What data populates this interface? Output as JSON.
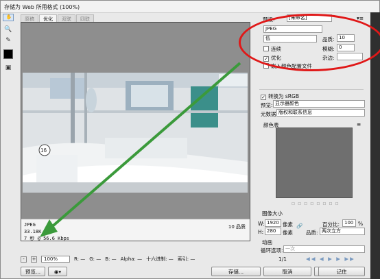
{
  "window": {
    "title": "存储为 Web 所用格式 (100%)"
  },
  "tabs": [
    "原稿",
    "优化",
    "双联",
    "四联"
  ],
  "active_tab": 1,
  "preview": {
    "format": "JPEG",
    "size": "33.18K",
    "time": "7 秒 @ 56.6 Kbps",
    "quality_note": "10 品质"
  },
  "bottombar": {
    "zoom": "100%",
    "r": "R: —",
    "g": "G: —",
    "b": "B: —",
    "alpha": "Alpha: —",
    "hex": "十六进制: —",
    "index": "索引: —"
  },
  "buttons": {
    "preview": "预览...",
    "save": "存储...",
    "cancel": "取消",
    "reset": "复位",
    "remember": "记住"
  },
  "settings": {
    "preset_label": "预设:",
    "preset_value": "[未命名]",
    "format": "JPEG",
    "quality_level": "低",
    "quality_label": "品质:",
    "quality_value": "10",
    "progressive": "连续",
    "blur_label": "模糊:",
    "blur_value": "0",
    "optimized": "优化",
    "matte_label": "杂边:",
    "embed_profile": "嵌入颜色配置文件",
    "convert_srgb": "转换为 sRGB",
    "preview_label": "预览:",
    "preview_value": "显示器颜色",
    "metadata_label": "元数据:",
    "metadata_value": "版权和联系信息",
    "color_table": "颜色表"
  },
  "image_size": {
    "title": "图像大小",
    "w_label": "W:",
    "w_value": "1920",
    "h_label": "H:",
    "h_value": "280",
    "unit": "像素",
    "percent_label": "百分比:",
    "percent_value": "100",
    "percent_unit": "%",
    "quality_label": "品质:",
    "quality_value": "两次立方"
  },
  "animation": {
    "title": "动画",
    "loop_label": "循环选项:",
    "loop_value": "一次",
    "frame": "1/1"
  }
}
